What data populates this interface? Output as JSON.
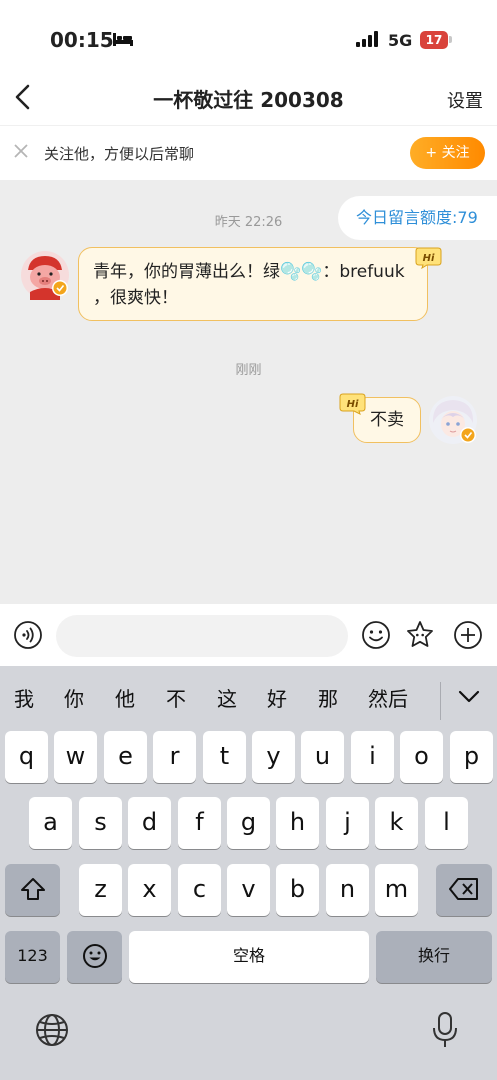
{
  "status_bar": {
    "time": "00:15",
    "network": "5G",
    "battery": "17"
  },
  "nav": {
    "title": "一杯敬过往 200308",
    "settings_label": "设置"
  },
  "follow_bar": {
    "hint": "关注他，方便以后常聊",
    "follow_label": "+ 关注"
  },
  "chat": {
    "quota": "今日留言额度:79",
    "timestamp_1": "昨天 22:26",
    "message_1": "青年，你的胃薄出么！绿🫧🫧：brefuuk ，很爽快！",
    "timestamp_2": "刚刚",
    "message_2": "不卖"
  },
  "input": {
    "placeholder": ""
  },
  "keyboard": {
    "candidates": [
      "我",
      "你",
      "他",
      "不",
      "这",
      "好",
      "那",
      "然后"
    ],
    "row1": [
      "q",
      "w",
      "e",
      "r",
      "t",
      "y",
      "u",
      "i",
      "o",
      "p"
    ],
    "row2": [
      "a",
      "s",
      "d",
      "f",
      "g",
      "h",
      "j",
      "k",
      "l"
    ],
    "row3": [
      "z",
      "x",
      "c",
      "v",
      "b",
      "n",
      "m"
    ],
    "numbers_label": "123",
    "space_label": "空格",
    "return_label": "换行"
  },
  "colors": {
    "accent_orange": "#ff8a00",
    "quota_blue": "#2f8fd8",
    "bubble_fill": "#fff8e6",
    "bubble_border": "#f1c060"
  },
  "icons": [
    "bed-icon",
    "signal-icon",
    "back-icon",
    "close-icon",
    "hi-badge-icon",
    "voice-icon",
    "emoji-icon",
    "sticker-icon",
    "plus-icon",
    "shift-icon",
    "delete-icon",
    "globe-icon",
    "mic-icon"
  ]
}
